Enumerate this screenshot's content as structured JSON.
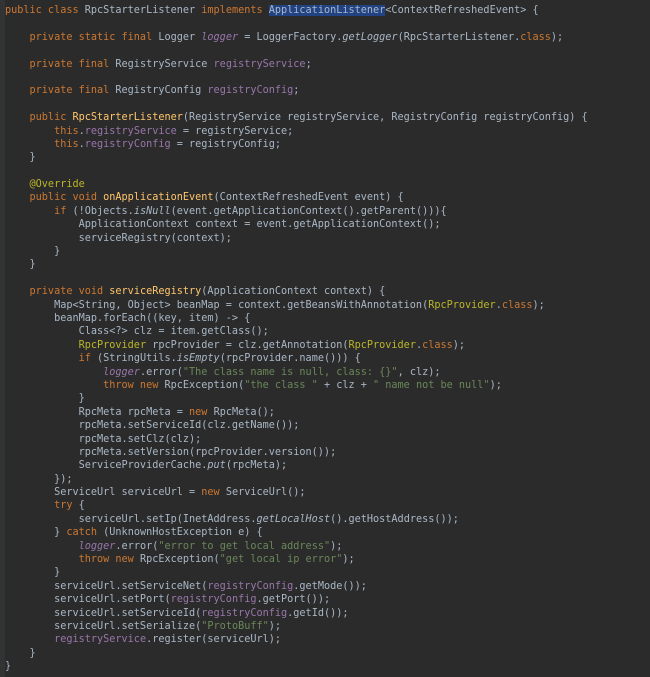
{
  "editor": {
    "lines": [
      [
        {
          "t": "public class ",
          "c": "k"
        },
        {
          "t": "RpcStarterListener "
        },
        {
          "t": "implements ",
          "c": "k"
        },
        {
          "t": "ApplicationListener",
          "c": "sel"
        },
        {
          "t": "<ContextRefreshedEvent> {"
        }
      ],
      [
        {
          "t": ""
        }
      ],
      [
        {
          "t": "    private static final ",
          "c": "k"
        },
        {
          "t": "Logger "
        },
        {
          "t": "logger",
          "c": "st"
        },
        {
          "t": " = LoggerFactory."
        },
        {
          "t": "getLogger",
          "c": "i"
        },
        {
          "t": "(RpcStarterListener."
        },
        {
          "t": "class",
          "c": "k"
        },
        {
          "t": ");"
        }
      ],
      [
        {
          "t": ""
        }
      ],
      [
        {
          "t": "    private final ",
          "c": "k"
        },
        {
          "t": "RegistryService "
        },
        {
          "t": "registryService",
          "c": "fl"
        },
        {
          "t": ";"
        }
      ],
      [
        {
          "t": ""
        }
      ],
      [
        {
          "t": "    private final ",
          "c": "k"
        },
        {
          "t": "RegistryConfig "
        },
        {
          "t": "registryConfig",
          "c": "fl"
        },
        {
          "t": ";"
        }
      ],
      [
        {
          "t": ""
        }
      ],
      [
        {
          "t": "    public ",
          "c": "k"
        },
        {
          "t": "RpcStarterListener",
          "c": "f"
        },
        {
          "t": "(RegistryService registryService, RegistryConfig registryConfig) {"
        }
      ],
      [
        {
          "t": "        this",
          "c": "k"
        },
        {
          "t": "."
        },
        {
          "t": "registryService",
          "c": "fl"
        },
        {
          "t": " = registryService;"
        }
      ],
      [
        {
          "t": "        this",
          "c": "k"
        },
        {
          "t": "."
        },
        {
          "t": "registryConfig",
          "c": "fl"
        },
        {
          "t": " = registryConfig;"
        }
      ],
      [
        {
          "t": "    }"
        }
      ],
      [
        {
          "t": ""
        }
      ],
      [
        {
          "t": "    @Override",
          "c": "a"
        }
      ],
      [
        {
          "t": "    public void ",
          "c": "k"
        },
        {
          "t": "onApplicationEvent",
          "c": "f"
        },
        {
          "t": "(ContextRefreshedEvent event) {"
        }
      ],
      [
        {
          "t": "        if ",
          "c": "k"
        },
        {
          "t": "(!Objects."
        },
        {
          "t": "isNull",
          "c": "i"
        },
        {
          "t": "(event.getApplicationContext().getParent())){"
        }
      ],
      [
        {
          "t": "            ApplicationContext context = event.getApplicationContext();"
        }
      ],
      [
        {
          "t": "            serviceRegistry(context);"
        }
      ],
      [
        {
          "t": "        }"
        }
      ],
      [
        {
          "t": "    }"
        }
      ],
      [
        {
          "t": ""
        }
      ],
      [
        {
          "t": "    private void ",
          "c": "k"
        },
        {
          "t": "serviceRegistry",
          "c": "f"
        },
        {
          "t": "(ApplicationContext context) {"
        }
      ],
      [
        {
          "t": "        Map<String, Object> beanMap = context.getBeansWithAnnotation("
        },
        {
          "t": "RpcProvider",
          "c": "a"
        },
        {
          "t": "."
        },
        {
          "t": "class",
          "c": "k"
        },
        {
          "t": ");"
        }
      ],
      [
        {
          "t": "        beanMap.forEach((key, item) -> {"
        }
      ],
      [
        {
          "t": "            Class<?> clz = item.getClass();"
        }
      ],
      [
        {
          "t": "            "
        },
        {
          "t": "RpcProvider",
          "c": "a"
        },
        {
          "t": " rpcProvider = clz.getAnnotation("
        },
        {
          "t": "RpcProvider",
          "c": "a"
        },
        {
          "t": "."
        },
        {
          "t": "class",
          "c": "k"
        },
        {
          "t": ");"
        }
      ],
      [
        {
          "t": "            if ",
          "c": "k"
        },
        {
          "t": "(StringUtils."
        },
        {
          "t": "isEmpty",
          "c": "i"
        },
        {
          "t": "(rpcProvider.name())) {"
        }
      ],
      [
        {
          "t": "                "
        },
        {
          "t": "logger",
          "c": "st"
        },
        {
          "t": ".error("
        },
        {
          "t": "\"The class name is null, class: {}\"",
          "c": "s"
        },
        {
          "t": ", clz);"
        }
      ],
      [
        {
          "t": "                throw new ",
          "c": "k"
        },
        {
          "t": "RpcException("
        },
        {
          "t": "\"the class \"",
          "c": "s"
        },
        {
          "t": " + clz + "
        },
        {
          "t": "\" name not be null\"",
          "c": "s"
        },
        {
          "t": ");"
        }
      ],
      [
        {
          "t": "            }"
        }
      ],
      [
        {
          "t": "            RpcMeta rpcMeta = "
        },
        {
          "t": "new ",
          "c": "k"
        },
        {
          "t": "RpcMeta();"
        }
      ],
      [
        {
          "t": "            rpcMeta.setServiceId(clz.getName());"
        }
      ],
      [
        {
          "t": "            rpcMeta.setClz(clz);"
        }
      ],
      [
        {
          "t": "            rpcMeta.setVersion(rpcProvider.version());"
        }
      ],
      [
        {
          "t": "            ServiceProviderCache."
        },
        {
          "t": "put",
          "c": "i"
        },
        {
          "t": "(rpcMeta);"
        }
      ],
      [
        {
          "t": "        });"
        }
      ],
      [
        {
          "t": "        ServiceUrl serviceUrl = "
        },
        {
          "t": "new ",
          "c": "k"
        },
        {
          "t": "ServiceUrl();"
        }
      ],
      [
        {
          "t": "        try ",
          "c": "k"
        },
        {
          "t": "{"
        }
      ],
      [
        {
          "t": "            serviceUrl.setIp(InetAddress."
        },
        {
          "t": "getLocalHost",
          "c": "i"
        },
        {
          "t": "().getHostAddress());"
        }
      ],
      [
        {
          "t": "        } "
        },
        {
          "t": "catch ",
          "c": "k"
        },
        {
          "t": "(UnknownHostException e) {"
        }
      ],
      [
        {
          "t": "            "
        },
        {
          "t": "logger",
          "c": "st"
        },
        {
          "t": ".error("
        },
        {
          "t": "\"error to get local address\"",
          "c": "s"
        },
        {
          "t": ");"
        }
      ],
      [
        {
          "t": "            throw new ",
          "c": "k"
        },
        {
          "t": "RpcException("
        },
        {
          "t": "\"get local ip error\"",
          "c": "s"
        },
        {
          "t": ");"
        }
      ],
      [
        {
          "t": "        }"
        }
      ],
      [
        {
          "t": "        serviceUrl.setServiceNet("
        },
        {
          "t": "registryConfig",
          "c": "fl"
        },
        {
          "t": ".getMode());"
        }
      ],
      [
        {
          "t": "        serviceUrl.setPort("
        },
        {
          "t": "registryConfig",
          "c": "fl"
        },
        {
          "t": ".getPort());"
        }
      ],
      [
        {
          "t": "        serviceUrl.setServiceId("
        },
        {
          "t": "registryConfig",
          "c": "fl"
        },
        {
          "t": ".getId());"
        }
      ],
      [
        {
          "t": "        serviceUrl.setSerialize("
        },
        {
          "t": "\"ProtoBuff\"",
          "c": "s"
        },
        {
          "t": ");"
        }
      ],
      [
        {
          "t": "        "
        },
        {
          "t": "registryService",
          "c": "fl"
        },
        {
          "t": ".register(serviceUrl);"
        }
      ],
      [
        {
          "t": "    }"
        }
      ],
      [
        {
          "t": "}"
        }
      ]
    ]
  }
}
